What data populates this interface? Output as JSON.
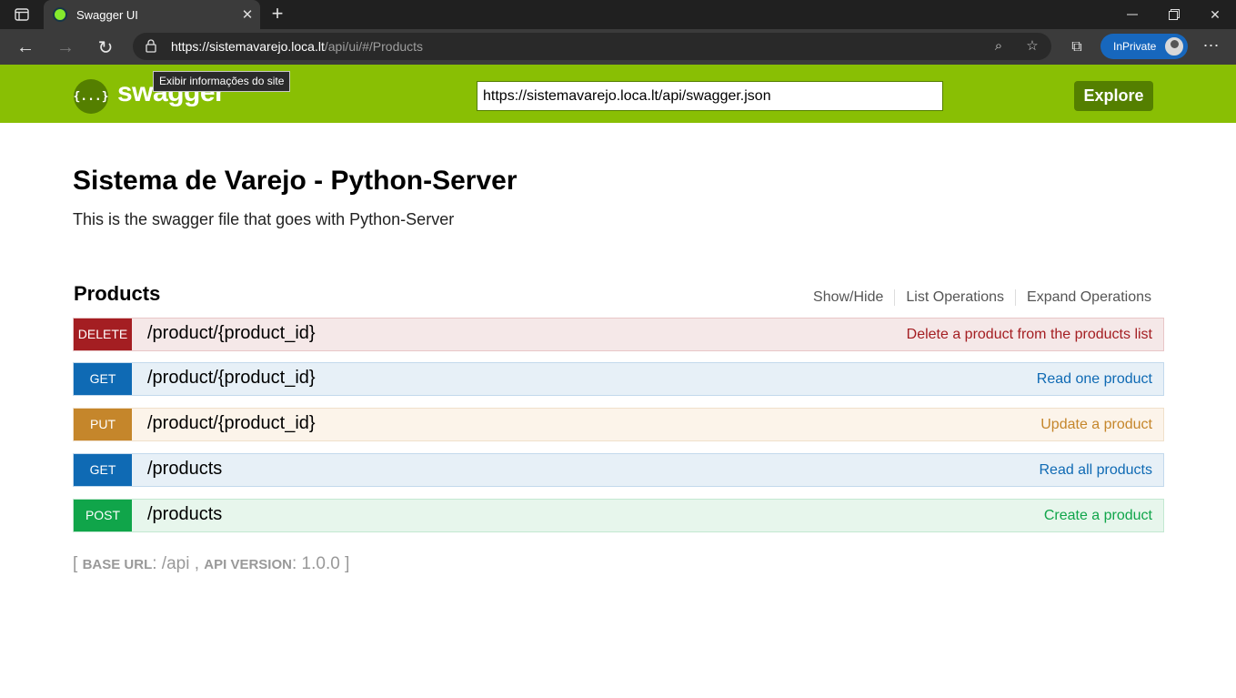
{
  "browser": {
    "tab_title": "Swagger UI",
    "url_host": "https://sistemavarejo.loca.lt",
    "url_path": "/api/ui/#/Products",
    "tooltip": "Exibir informações do site",
    "inprivate_label": "InPrivate"
  },
  "swagger": {
    "logo_text": "swagger",
    "logo_icon_text": "{...}",
    "spec_url": "https://sistemavarejo.loca.lt/api/swagger.json",
    "explore_label": "Explore",
    "brand_color": "#89bf04"
  },
  "info": {
    "title": "Sistema de Varejo - Python-Server",
    "description": "This is the swagger file that goes with Python-Server"
  },
  "resource": {
    "name": "Products",
    "actions": [
      "Show/Hide",
      "List Operations",
      "Expand Operations"
    ],
    "operations": [
      {
        "method": "DELETE",
        "path": "/product/{product_id}",
        "summary": "Delete a product from the products list",
        "color": "#a41e22"
      },
      {
        "method": "GET",
        "path": "/product/{product_id}",
        "summary": "Read one product",
        "color": "#0f6ab4"
      },
      {
        "method": "PUT",
        "path": "/product/{product_id}",
        "summary": "Update a product",
        "color": "#c5862b"
      },
      {
        "method": "GET",
        "path": "/products",
        "summary": "Read all products",
        "color": "#0f6ab4"
      },
      {
        "method": "POST",
        "path": "/products",
        "summary": "Create a product",
        "color": "#10a54a"
      }
    ]
  },
  "footer": {
    "base_url_label": "base url",
    "base_url": "/api",
    "api_version_label": "api version",
    "api_version": "1.0.0"
  }
}
